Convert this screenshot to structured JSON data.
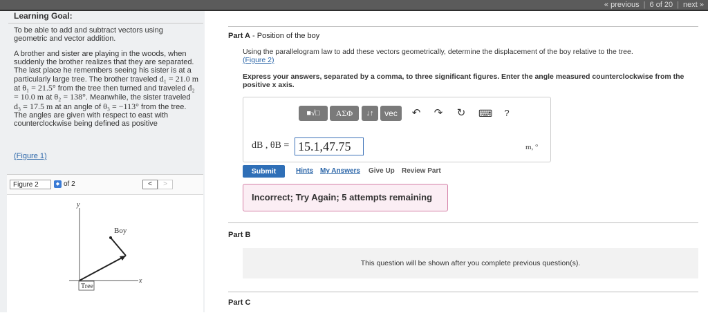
{
  "pager": {
    "previous": "« previous",
    "position": "6 of 20",
    "next": "next »"
  },
  "goal": {
    "title": "Learning Goal:",
    "text": "To be able to add and subtract vectors using geometric and vector addition."
  },
  "story": {
    "p1": "A brother and sister are playing in the woods, when suddenly the brother realizes that they are separated. The last place he remembers seeing his sister is at a particularly large tree. The brother traveled",
    "d1": "d₁ = 21.0 m",
    "at1": " at ",
    "th1": "θ₁ = 21.5°",
    "p2": " from the tree then turned and traveled ",
    "d2": "d₂ = 10.0 m",
    "at2": " at ",
    "th2": "θ₂ = 138°",
    "p3": ". Meanwhile, the sister traveled ",
    "d3": "d₃ = 17.5 m",
    "p4": " at an angle of ",
    "th3": "θ₃ = −113°",
    "p5": " from the tree. The angles are given with respect to east with counterclockwise being defined as positive"
  },
  "figure_link": "(Figure 1)",
  "figure_panel": {
    "select_value": "Figure 2",
    "of_text": "of 2",
    "prev_symbol": "<",
    "next_symbol": ">",
    "labels": {
      "y_axis": "y",
      "x_axis": "x",
      "boy": "Boy",
      "tree": "Tree"
    }
  },
  "partA": {
    "title_bold": "Part A",
    "title_rest": " - Position of the boy",
    "instruction": "Using the parallelogram law to add these vectors geometrically, determine the displacement of the boy relative to the tree.",
    "figure_link": "(Figure 2)",
    "bold_instruction": "Express your answers, separated by a comma, to three significant figures. Enter the angle measured counterclockwise from the positive x axis.",
    "toolbar": {
      "templates": "■√□",
      "greek": "AΣΦ",
      "sort": "↓↑",
      "vec": "vec",
      "undo": "↶",
      "redo": "↷",
      "reset": "↻",
      "keyboard": "⌨",
      "help": "?"
    },
    "eq_label": "dB , θB =",
    "answer_value": "15.1,47.75",
    "units": "m, °",
    "submit": "Submit",
    "hints": "Hints",
    "my_answers": "My Answers",
    "give_up": "Give Up",
    "review": "Review Part",
    "feedback": "Incorrect; Try Again; 5 attempts remaining"
  },
  "partB": {
    "title": "Part B",
    "locked_message": "This question will be shown after you complete previous question(s)."
  },
  "partC": {
    "title": "Part C"
  },
  "colors": {
    "accent": "#2f6fb7",
    "feedback_border": "#d47fa6",
    "feedback_bg": "#fbeef4"
  }
}
